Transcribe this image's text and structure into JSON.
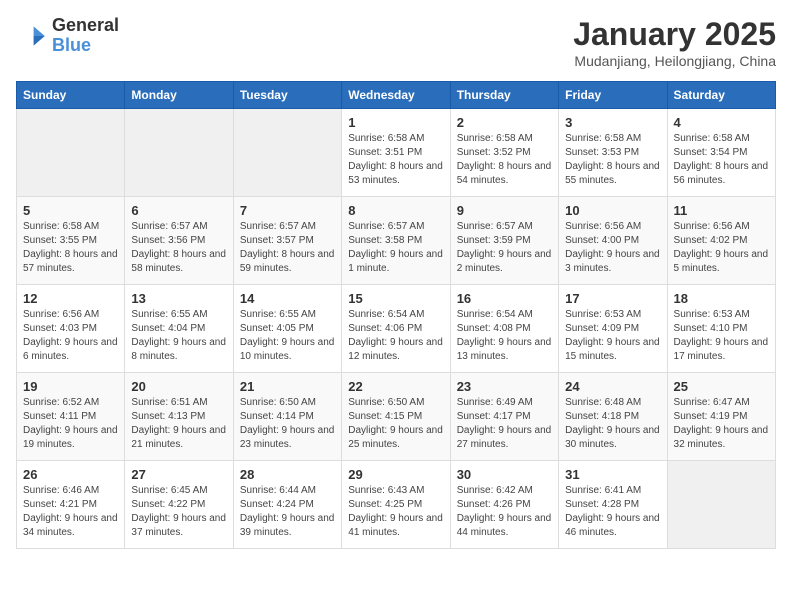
{
  "logo": {
    "line1": "General",
    "line2": "Blue"
  },
  "title": "January 2025",
  "subtitle": "Mudanjiang, Heilongjiang, China",
  "weekdays": [
    "Sunday",
    "Monday",
    "Tuesday",
    "Wednesday",
    "Thursday",
    "Friday",
    "Saturday"
  ],
  "weeks": [
    [
      {
        "day": "",
        "info": ""
      },
      {
        "day": "",
        "info": ""
      },
      {
        "day": "",
        "info": ""
      },
      {
        "day": "1",
        "info": "Sunrise: 6:58 AM\nSunset: 3:51 PM\nDaylight: 8 hours and 53 minutes."
      },
      {
        "day": "2",
        "info": "Sunrise: 6:58 AM\nSunset: 3:52 PM\nDaylight: 8 hours and 54 minutes."
      },
      {
        "day": "3",
        "info": "Sunrise: 6:58 AM\nSunset: 3:53 PM\nDaylight: 8 hours and 55 minutes."
      },
      {
        "day": "4",
        "info": "Sunrise: 6:58 AM\nSunset: 3:54 PM\nDaylight: 8 hours and 56 minutes."
      }
    ],
    [
      {
        "day": "5",
        "info": "Sunrise: 6:58 AM\nSunset: 3:55 PM\nDaylight: 8 hours and 57 minutes."
      },
      {
        "day": "6",
        "info": "Sunrise: 6:57 AM\nSunset: 3:56 PM\nDaylight: 8 hours and 58 minutes."
      },
      {
        "day": "7",
        "info": "Sunrise: 6:57 AM\nSunset: 3:57 PM\nDaylight: 8 hours and 59 minutes."
      },
      {
        "day": "8",
        "info": "Sunrise: 6:57 AM\nSunset: 3:58 PM\nDaylight: 9 hours and 1 minute."
      },
      {
        "day": "9",
        "info": "Sunrise: 6:57 AM\nSunset: 3:59 PM\nDaylight: 9 hours and 2 minutes."
      },
      {
        "day": "10",
        "info": "Sunrise: 6:56 AM\nSunset: 4:00 PM\nDaylight: 9 hours and 3 minutes."
      },
      {
        "day": "11",
        "info": "Sunrise: 6:56 AM\nSunset: 4:02 PM\nDaylight: 9 hours and 5 minutes."
      }
    ],
    [
      {
        "day": "12",
        "info": "Sunrise: 6:56 AM\nSunset: 4:03 PM\nDaylight: 9 hours and 6 minutes."
      },
      {
        "day": "13",
        "info": "Sunrise: 6:55 AM\nSunset: 4:04 PM\nDaylight: 9 hours and 8 minutes."
      },
      {
        "day": "14",
        "info": "Sunrise: 6:55 AM\nSunset: 4:05 PM\nDaylight: 9 hours and 10 minutes."
      },
      {
        "day": "15",
        "info": "Sunrise: 6:54 AM\nSunset: 4:06 PM\nDaylight: 9 hours and 12 minutes."
      },
      {
        "day": "16",
        "info": "Sunrise: 6:54 AM\nSunset: 4:08 PM\nDaylight: 9 hours and 13 minutes."
      },
      {
        "day": "17",
        "info": "Sunrise: 6:53 AM\nSunset: 4:09 PM\nDaylight: 9 hours and 15 minutes."
      },
      {
        "day": "18",
        "info": "Sunrise: 6:53 AM\nSunset: 4:10 PM\nDaylight: 9 hours and 17 minutes."
      }
    ],
    [
      {
        "day": "19",
        "info": "Sunrise: 6:52 AM\nSunset: 4:11 PM\nDaylight: 9 hours and 19 minutes."
      },
      {
        "day": "20",
        "info": "Sunrise: 6:51 AM\nSunset: 4:13 PM\nDaylight: 9 hours and 21 minutes."
      },
      {
        "day": "21",
        "info": "Sunrise: 6:50 AM\nSunset: 4:14 PM\nDaylight: 9 hours and 23 minutes."
      },
      {
        "day": "22",
        "info": "Sunrise: 6:50 AM\nSunset: 4:15 PM\nDaylight: 9 hours and 25 minutes."
      },
      {
        "day": "23",
        "info": "Sunrise: 6:49 AM\nSunset: 4:17 PM\nDaylight: 9 hours and 27 minutes."
      },
      {
        "day": "24",
        "info": "Sunrise: 6:48 AM\nSunset: 4:18 PM\nDaylight: 9 hours and 30 minutes."
      },
      {
        "day": "25",
        "info": "Sunrise: 6:47 AM\nSunset: 4:19 PM\nDaylight: 9 hours and 32 minutes."
      }
    ],
    [
      {
        "day": "26",
        "info": "Sunrise: 6:46 AM\nSunset: 4:21 PM\nDaylight: 9 hours and 34 minutes."
      },
      {
        "day": "27",
        "info": "Sunrise: 6:45 AM\nSunset: 4:22 PM\nDaylight: 9 hours and 37 minutes."
      },
      {
        "day": "28",
        "info": "Sunrise: 6:44 AM\nSunset: 4:24 PM\nDaylight: 9 hours and 39 minutes."
      },
      {
        "day": "29",
        "info": "Sunrise: 6:43 AM\nSunset: 4:25 PM\nDaylight: 9 hours and 41 minutes."
      },
      {
        "day": "30",
        "info": "Sunrise: 6:42 AM\nSunset: 4:26 PM\nDaylight: 9 hours and 44 minutes."
      },
      {
        "day": "31",
        "info": "Sunrise: 6:41 AM\nSunset: 4:28 PM\nDaylight: 9 hours and 46 minutes."
      },
      {
        "day": "",
        "info": ""
      }
    ]
  ]
}
